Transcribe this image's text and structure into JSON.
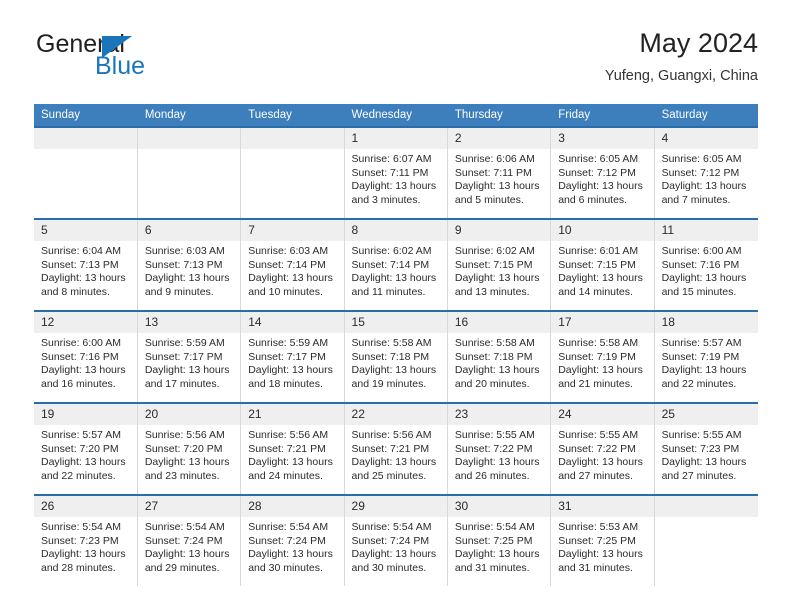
{
  "logo": {
    "word1": "General",
    "word2": "Blue",
    "triangle_color": "#1b75bb",
    "word1_color": "#231f20",
    "word2_color": "#1b75bb"
  },
  "header": {
    "title": "May 2024",
    "subtitle": "Yufeng, Guangxi, China"
  },
  "theme": {
    "header_blue": "#3d7ebc",
    "row_rule_blue": "#2a6dad",
    "daynum_gray": "#efefef",
    "grid_gray": "#d8d8d8"
  },
  "weekdays": [
    "Sunday",
    "Monday",
    "Tuesday",
    "Wednesday",
    "Thursday",
    "Friday",
    "Saturday"
  ],
  "weeks": [
    [
      {
        "day": "",
        "lines": []
      },
      {
        "day": "",
        "lines": []
      },
      {
        "day": "",
        "lines": []
      },
      {
        "day": "1",
        "lines": [
          "Sunrise: 6:07 AM",
          "Sunset: 7:11 PM",
          "Daylight: 13 hours",
          "and 3 minutes."
        ]
      },
      {
        "day": "2",
        "lines": [
          "Sunrise: 6:06 AM",
          "Sunset: 7:11 PM",
          "Daylight: 13 hours",
          "and 5 minutes."
        ]
      },
      {
        "day": "3",
        "lines": [
          "Sunrise: 6:05 AM",
          "Sunset: 7:12 PM",
          "Daylight: 13 hours",
          "and 6 minutes."
        ]
      },
      {
        "day": "4",
        "lines": [
          "Sunrise: 6:05 AM",
          "Sunset: 7:12 PM",
          "Daylight: 13 hours",
          "and 7 minutes."
        ]
      }
    ],
    [
      {
        "day": "5",
        "lines": [
          "Sunrise: 6:04 AM",
          "Sunset: 7:13 PM",
          "Daylight: 13 hours",
          "and 8 minutes."
        ]
      },
      {
        "day": "6",
        "lines": [
          "Sunrise: 6:03 AM",
          "Sunset: 7:13 PM",
          "Daylight: 13 hours",
          "and 9 minutes."
        ]
      },
      {
        "day": "7",
        "lines": [
          "Sunrise: 6:03 AM",
          "Sunset: 7:14 PM",
          "Daylight: 13 hours",
          "and 10 minutes."
        ]
      },
      {
        "day": "8",
        "lines": [
          "Sunrise: 6:02 AM",
          "Sunset: 7:14 PM",
          "Daylight: 13 hours",
          "and 11 minutes."
        ]
      },
      {
        "day": "9",
        "lines": [
          "Sunrise: 6:02 AM",
          "Sunset: 7:15 PM",
          "Daylight: 13 hours",
          "and 13 minutes."
        ]
      },
      {
        "day": "10",
        "lines": [
          "Sunrise: 6:01 AM",
          "Sunset: 7:15 PM",
          "Daylight: 13 hours",
          "and 14 minutes."
        ]
      },
      {
        "day": "11",
        "lines": [
          "Sunrise: 6:00 AM",
          "Sunset: 7:16 PM",
          "Daylight: 13 hours",
          "and 15 minutes."
        ]
      }
    ],
    [
      {
        "day": "12",
        "lines": [
          "Sunrise: 6:00 AM",
          "Sunset: 7:16 PM",
          "Daylight: 13 hours",
          "and 16 minutes."
        ]
      },
      {
        "day": "13",
        "lines": [
          "Sunrise: 5:59 AM",
          "Sunset: 7:17 PM",
          "Daylight: 13 hours",
          "and 17 minutes."
        ]
      },
      {
        "day": "14",
        "lines": [
          "Sunrise: 5:59 AM",
          "Sunset: 7:17 PM",
          "Daylight: 13 hours",
          "and 18 minutes."
        ]
      },
      {
        "day": "15",
        "lines": [
          "Sunrise: 5:58 AM",
          "Sunset: 7:18 PM",
          "Daylight: 13 hours",
          "and 19 minutes."
        ]
      },
      {
        "day": "16",
        "lines": [
          "Sunrise: 5:58 AM",
          "Sunset: 7:18 PM",
          "Daylight: 13 hours",
          "and 20 minutes."
        ]
      },
      {
        "day": "17",
        "lines": [
          "Sunrise: 5:58 AM",
          "Sunset: 7:19 PM",
          "Daylight: 13 hours",
          "and 21 minutes."
        ]
      },
      {
        "day": "18",
        "lines": [
          "Sunrise: 5:57 AM",
          "Sunset: 7:19 PM",
          "Daylight: 13 hours",
          "and 22 minutes."
        ]
      }
    ],
    [
      {
        "day": "19",
        "lines": [
          "Sunrise: 5:57 AM",
          "Sunset: 7:20 PM",
          "Daylight: 13 hours",
          "and 22 minutes."
        ]
      },
      {
        "day": "20",
        "lines": [
          "Sunrise: 5:56 AM",
          "Sunset: 7:20 PM",
          "Daylight: 13 hours",
          "and 23 minutes."
        ]
      },
      {
        "day": "21",
        "lines": [
          "Sunrise: 5:56 AM",
          "Sunset: 7:21 PM",
          "Daylight: 13 hours",
          "and 24 minutes."
        ]
      },
      {
        "day": "22",
        "lines": [
          "Sunrise: 5:56 AM",
          "Sunset: 7:21 PM",
          "Daylight: 13 hours",
          "and 25 minutes."
        ]
      },
      {
        "day": "23",
        "lines": [
          "Sunrise: 5:55 AM",
          "Sunset: 7:22 PM",
          "Daylight: 13 hours",
          "and 26 minutes."
        ]
      },
      {
        "day": "24",
        "lines": [
          "Sunrise: 5:55 AM",
          "Sunset: 7:22 PM",
          "Daylight: 13 hours",
          "and 27 minutes."
        ]
      },
      {
        "day": "25",
        "lines": [
          "Sunrise: 5:55 AM",
          "Sunset: 7:23 PM",
          "Daylight: 13 hours",
          "and 27 minutes."
        ]
      }
    ],
    [
      {
        "day": "26",
        "lines": [
          "Sunrise: 5:54 AM",
          "Sunset: 7:23 PM",
          "Daylight: 13 hours",
          "and 28 minutes."
        ]
      },
      {
        "day": "27",
        "lines": [
          "Sunrise: 5:54 AM",
          "Sunset: 7:24 PM",
          "Daylight: 13 hours",
          "and 29 minutes."
        ]
      },
      {
        "day": "28",
        "lines": [
          "Sunrise: 5:54 AM",
          "Sunset: 7:24 PM",
          "Daylight: 13 hours",
          "and 30 minutes."
        ]
      },
      {
        "day": "29",
        "lines": [
          "Sunrise: 5:54 AM",
          "Sunset: 7:24 PM",
          "Daylight: 13 hours",
          "and 30 minutes."
        ]
      },
      {
        "day": "30",
        "lines": [
          "Sunrise: 5:54 AM",
          "Sunset: 7:25 PM",
          "Daylight: 13 hours",
          "and 31 minutes."
        ]
      },
      {
        "day": "31",
        "lines": [
          "Sunrise: 5:53 AM",
          "Sunset: 7:25 PM",
          "Daylight: 13 hours",
          "and 31 minutes."
        ]
      },
      {
        "day": "",
        "lines": []
      }
    ]
  ]
}
